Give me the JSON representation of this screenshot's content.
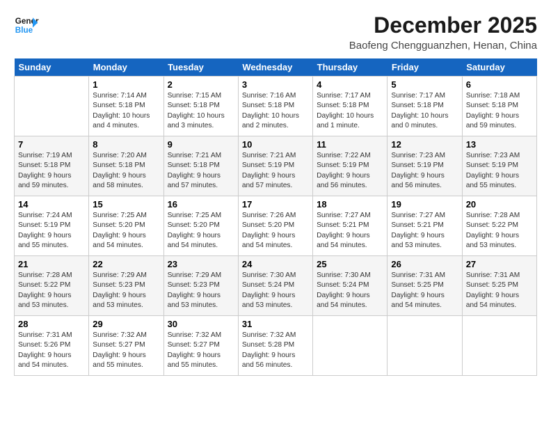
{
  "logo": {
    "line1": "General",
    "line2": "Blue"
  },
  "title": "December 2025",
  "location": "Baofeng Chengguanzhen, Henan, China",
  "days_of_week": [
    "Sunday",
    "Monday",
    "Tuesday",
    "Wednesday",
    "Thursday",
    "Friday",
    "Saturday"
  ],
  "weeks": [
    [
      {
        "num": "",
        "info": ""
      },
      {
        "num": "1",
        "info": "Sunrise: 7:14 AM\nSunset: 5:18 PM\nDaylight: 10 hours\nand 4 minutes."
      },
      {
        "num": "2",
        "info": "Sunrise: 7:15 AM\nSunset: 5:18 PM\nDaylight: 10 hours\nand 3 minutes."
      },
      {
        "num": "3",
        "info": "Sunrise: 7:16 AM\nSunset: 5:18 PM\nDaylight: 10 hours\nand 2 minutes."
      },
      {
        "num": "4",
        "info": "Sunrise: 7:17 AM\nSunset: 5:18 PM\nDaylight: 10 hours\nand 1 minute."
      },
      {
        "num": "5",
        "info": "Sunrise: 7:17 AM\nSunset: 5:18 PM\nDaylight: 10 hours\nand 0 minutes."
      },
      {
        "num": "6",
        "info": "Sunrise: 7:18 AM\nSunset: 5:18 PM\nDaylight: 9 hours\nand 59 minutes."
      }
    ],
    [
      {
        "num": "7",
        "info": "Sunrise: 7:19 AM\nSunset: 5:18 PM\nDaylight: 9 hours\nand 59 minutes."
      },
      {
        "num": "8",
        "info": "Sunrise: 7:20 AM\nSunset: 5:18 PM\nDaylight: 9 hours\nand 58 minutes."
      },
      {
        "num": "9",
        "info": "Sunrise: 7:21 AM\nSunset: 5:18 PM\nDaylight: 9 hours\nand 57 minutes."
      },
      {
        "num": "10",
        "info": "Sunrise: 7:21 AM\nSunset: 5:19 PM\nDaylight: 9 hours\nand 57 minutes."
      },
      {
        "num": "11",
        "info": "Sunrise: 7:22 AM\nSunset: 5:19 PM\nDaylight: 9 hours\nand 56 minutes."
      },
      {
        "num": "12",
        "info": "Sunrise: 7:23 AM\nSunset: 5:19 PM\nDaylight: 9 hours\nand 56 minutes."
      },
      {
        "num": "13",
        "info": "Sunrise: 7:23 AM\nSunset: 5:19 PM\nDaylight: 9 hours\nand 55 minutes."
      }
    ],
    [
      {
        "num": "14",
        "info": "Sunrise: 7:24 AM\nSunset: 5:19 PM\nDaylight: 9 hours\nand 55 minutes."
      },
      {
        "num": "15",
        "info": "Sunrise: 7:25 AM\nSunset: 5:20 PM\nDaylight: 9 hours\nand 54 minutes."
      },
      {
        "num": "16",
        "info": "Sunrise: 7:25 AM\nSunset: 5:20 PM\nDaylight: 9 hours\nand 54 minutes."
      },
      {
        "num": "17",
        "info": "Sunrise: 7:26 AM\nSunset: 5:20 PM\nDaylight: 9 hours\nand 54 minutes."
      },
      {
        "num": "18",
        "info": "Sunrise: 7:27 AM\nSunset: 5:21 PM\nDaylight: 9 hours\nand 54 minutes."
      },
      {
        "num": "19",
        "info": "Sunrise: 7:27 AM\nSunset: 5:21 PM\nDaylight: 9 hours\nand 53 minutes."
      },
      {
        "num": "20",
        "info": "Sunrise: 7:28 AM\nSunset: 5:22 PM\nDaylight: 9 hours\nand 53 minutes."
      }
    ],
    [
      {
        "num": "21",
        "info": "Sunrise: 7:28 AM\nSunset: 5:22 PM\nDaylight: 9 hours\nand 53 minutes."
      },
      {
        "num": "22",
        "info": "Sunrise: 7:29 AM\nSunset: 5:23 PM\nDaylight: 9 hours\nand 53 minutes."
      },
      {
        "num": "23",
        "info": "Sunrise: 7:29 AM\nSunset: 5:23 PM\nDaylight: 9 hours\nand 53 minutes."
      },
      {
        "num": "24",
        "info": "Sunrise: 7:30 AM\nSunset: 5:24 PM\nDaylight: 9 hours\nand 53 minutes."
      },
      {
        "num": "25",
        "info": "Sunrise: 7:30 AM\nSunset: 5:24 PM\nDaylight: 9 hours\nand 54 minutes."
      },
      {
        "num": "26",
        "info": "Sunrise: 7:31 AM\nSunset: 5:25 PM\nDaylight: 9 hours\nand 54 minutes."
      },
      {
        "num": "27",
        "info": "Sunrise: 7:31 AM\nSunset: 5:25 PM\nDaylight: 9 hours\nand 54 minutes."
      }
    ],
    [
      {
        "num": "28",
        "info": "Sunrise: 7:31 AM\nSunset: 5:26 PM\nDaylight: 9 hours\nand 54 minutes."
      },
      {
        "num": "29",
        "info": "Sunrise: 7:32 AM\nSunset: 5:27 PM\nDaylight: 9 hours\nand 55 minutes."
      },
      {
        "num": "30",
        "info": "Sunrise: 7:32 AM\nSunset: 5:27 PM\nDaylight: 9 hours\nand 55 minutes."
      },
      {
        "num": "31",
        "info": "Sunrise: 7:32 AM\nSunset: 5:28 PM\nDaylight: 9 hours\nand 56 minutes."
      },
      {
        "num": "",
        "info": ""
      },
      {
        "num": "",
        "info": ""
      },
      {
        "num": "",
        "info": ""
      }
    ]
  ]
}
